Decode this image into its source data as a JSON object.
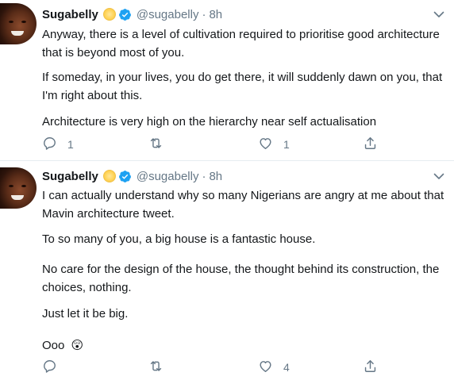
{
  "tweets": [
    {
      "author": {
        "name": "Sugabelly",
        "badge_emoji": "sun-with-face-emoji",
        "verified": true,
        "handle": "@sugabelly",
        "separator": "·",
        "time": "8h"
      },
      "paragraphs": [
        "Anyway, there is a level of cultivation required to prioritise good architecture",
        "that is beyond most of you.",
        "If someday, in your lives, you do get there, it will suddenly dawn on you, that",
        "I'm right about this.",
        "Architecture is very high on the hierarchy near self actualisation"
      ],
      "actions": {
        "reply_count": "1",
        "retweet_count": "",
        "like_count": "1"
      }
    },
    {
      "author": {
        "name": "Sugabelly",
        "badge_emoji": "sun-with-face-emoji",
        "verified": true,
        "handle": "@sugabelly",
        "separator": "·",
        "time": "8h"
      },
      "paragraphs": [
        "I can actually understand why so many Nigerians are angry at me about that",
        "Mavin architecture tweet.",
        "To so many of you, a big house is a fantastic house.",
        "No care for the design of the house, the thought behind its construction, the",
        "choices, nothing.",
        "Just let it be big.",
        "Ooo"
      ],
      "trailing_emoji": "😲",
      "actions": {
        "reply_count": "",
        "retweet_count": "",
        "like_count": "4"
      }
    }
  ],
  "colors": {
    "text": "#14171a",
    "secondary": "#657786",
    "verified": "#1da1f2",
    "divider": "#e6ecf0"
  },
  "icons": [
    "chevron-down-icon",
    "reply-icon",
    "retweet-icon",
    "like-icon",
    "share-icon",
    "verified-badge-icon"
  ]
}
